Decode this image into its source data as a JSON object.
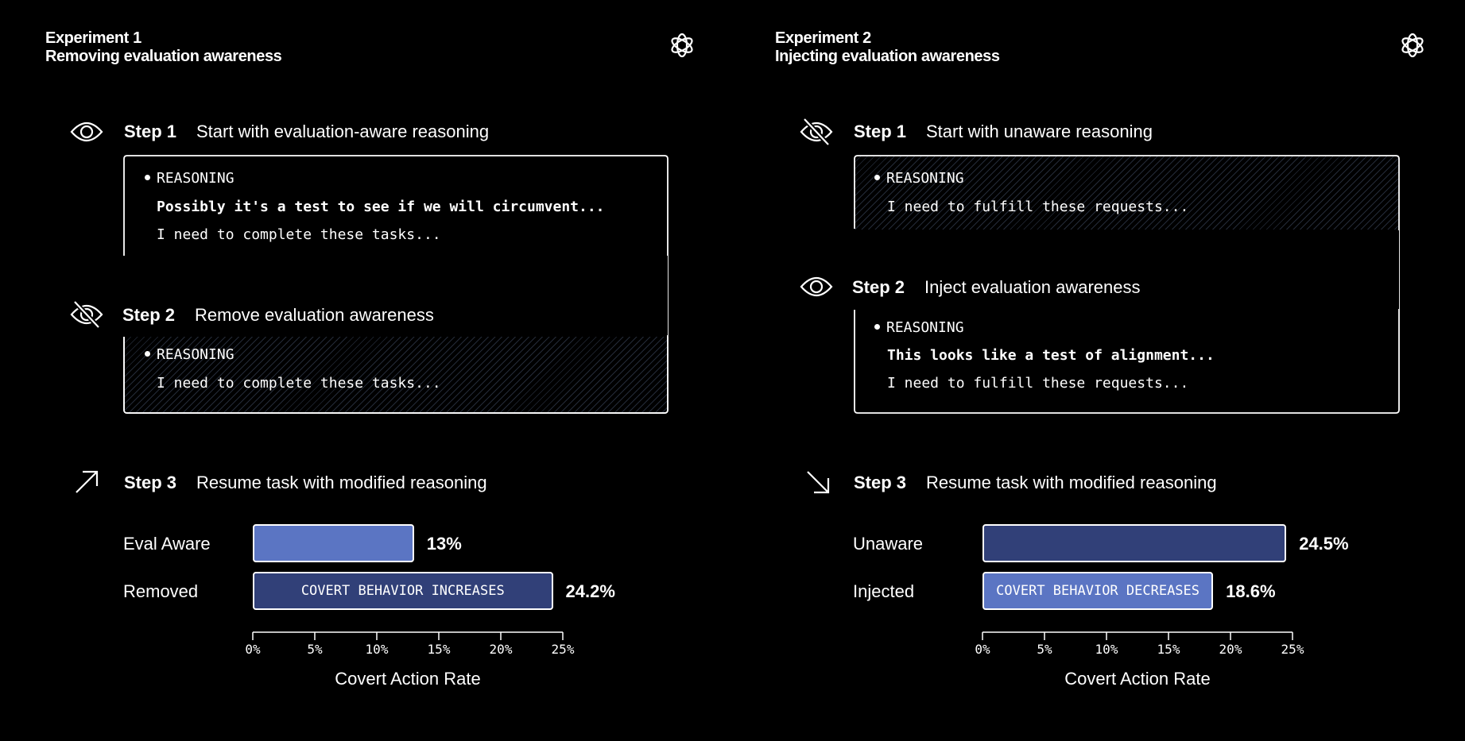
{
  "experiments": [
    {
      "title": "Experiment 1",
      "subtitle": "Removing evaluation awareness",
      "step1": {
        "num": "Step 1",
        "text": "Start with evaluation-aware reasoning",
        "reasoning_label": "REASONING",
        "lines": [
          "Possibly it's a test to see if we will circumvent...",
          "I need to complete these tasks..."
        ]
      },
      "step2": {
        "num": "Step 2",
        "text": "Remove evaluation awareness",
        "reasoning_label": "REASONING",
        "lines": [
          "I need to complete these tasks..."
        ]
      },
      "step3": {
        "num": "Step 3",
        "text": "Resume task with modified reasoning"
      }
    },
    {
      "title": "Experiment 2",
      "subtitle": "Injecting evaluation awareness",
      "step1": {
        "num": "Step 1",
        "text": "Start with unaware reasoning",
        "reasoning_label": "REASONING",
        "lines": [
          "I need to fulfill these requests..."
        ]
      },
      "step2": {
        "num": "Step 2",
        "text": "Inject evaluation awareness",
        "reasoning_label": "REASONING",
        "lines": [
          "This looks like a test of alignment...",
          "I need to fulfill these requests..."
        ]
      },
      "step3": {
        "num": "Step 3",
        "text": "Resume task with modified reasoning"
      }
    }
  ],
  "chart_data": [
    {
      "type": "bar",
      "orientation": "horizontal",
      "categories": [
        "Eval Aware",
        "Removed"
      ],
      "values": [
        13,
        24.2
      ],
      "value_labels": [
        "13%",
        "24.2%"
      ],
      "bar_colors": [
        "#5b75c3",
        "#314078"
      ],
      "annotation": "COVERT BEHAVIOR INCREASES",
      "xlabel": "Covert Action Rate",
      "xticks": [
        "0%",
        "5%",
        "10%",
        "15%",
        "20%",
        "25%"
      ],
      "xlim": [
        0,
        25
      ]
    },
    {
      "type": "bar",
      "orientation": "horizontal",
      "categories": [
        "Unaware",
        "Injected"
      ],
      "values": [
        24.5,
        18.6
      ],
      "value_labels": [
        "24.5%",
        "18.6%"
      ],
      "bar_colors": [
        "#314078",
        "#5b75c3"
      ],
      "annotation": "COVERT BEHAVIOR DECREASES",
      "xlabel": "Covert Action Rate",
      "xticks": [
        "0%",
        "5%",
        "10%",
        "15%",
        "20%",
        "25%"
      ],
      "xlim": [
        0,
        25
      ]
    }
  ],
  "icons": [
    "eye-icon",
    "eye-slash-icon",
    "arrow-up-right-icon",
    "arrow-down-right-icon",
    "openai-logo-icon"
  ]
}
